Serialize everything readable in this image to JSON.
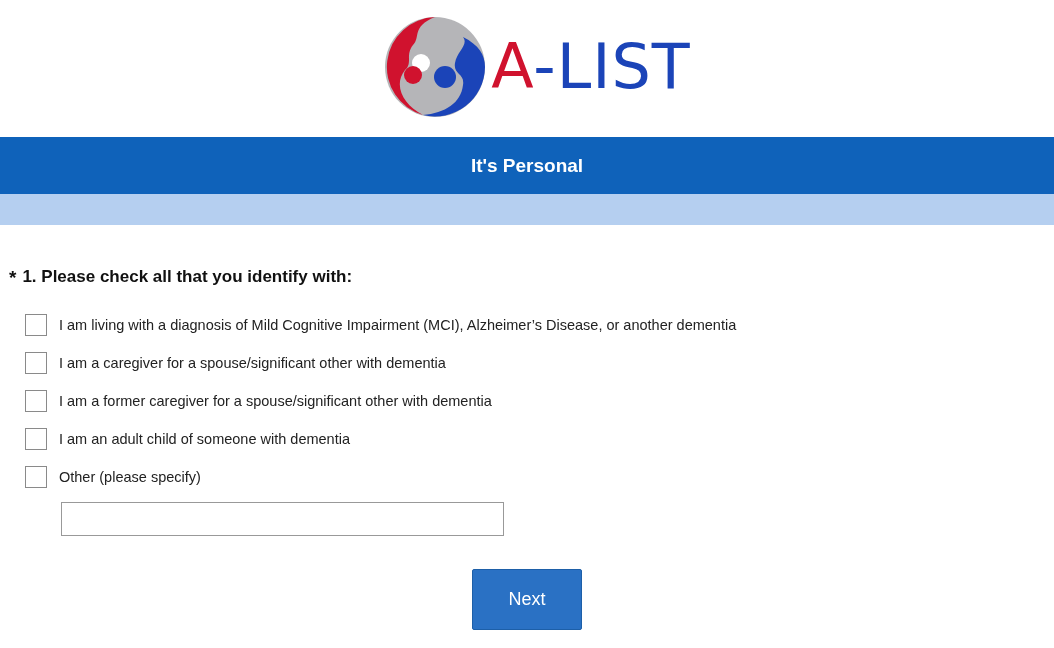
{
  "logo": {
    "parts": [
      {
        "text": "A",
        "color": "#d0122e"
      },
      {
        "text": "-LIST",
        "color": "#1b44b8"
      }
    ]
  },
  "header": {
    "title": "It's Personal"
  },
  "question": {
    "required_mark": "*",
    "title": "1. Please check all that you identify with:",
    "options": [
      {
        "label": "I am living with a diagnosis of Mild Cognitive Impairment (MCI), Alzheimer’s Disease, or another dementia",
        "checked": false
      },
      {
        "label": "I am a caregiver for a spouse/significant other with dementia",
        "checked": false
      },
      {
        "label": "I am a former caregiver for a spouse/significant other with dementia",
        "checked": false
      },
      {
        "label": "I am an adult child of someone with dementia",
        "checked": false
      },
      {
        "label": "Other (please specify)",
        "checked": false
      }
    ]
  },
  "next_button": "Next"
}
